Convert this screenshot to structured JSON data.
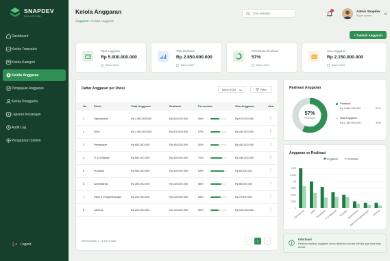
{
  "brand": {
    "name": "SNAPDEV",
    "tagline": "SOLUTIONS"
  },
  "sidebar": {
    "items": [
      {
        "label": "Dashboard",
        "icon": "home-icon"
      },
      {
        "label": "Kelola Transaksi",
        "icon": "transaction-icon"
      },
      {
        "label": "Kelola Kategori",
        "icon": "category-icon"
      },
      {
        "label": "Kelola Anggaran",
        "icon": "budget-icon",
        "active": true
      },
      {
        "label": "Pengajuan Anggaran",
        "icon": "submission-icon"
      },
      {
        "label": "Kelola Pengguna",
        "icon": "users-icon"
      },
      {
        "label": "Laporan Keuangan",
        "icon": "report-icon"
      },
      {
        "label": "Audit Log",
        "icon": "audit-icon"
      },
      {
        "label": "Pengaturan Sistem",
        "icon": "gear-icon"
      }
    ],
    "logout": "Logout"
  },
  "header": {
    "title": "Kelola Anggaran",
    "breadcrumb": [
      "Anggaran",
      "/",
      "Kelola Anggaran"
    ],
    "search_placeholder": "Cari sesuatu...",
    "user_name": "Admin Snapdev",
    "user_role": "Super Admin",
    "add_button": "+ Tambah Anggaran"
  },
  "stats": [
    {
      "label": "Total Anggaran",
      "value": "Rp 5.000.000.000",
      "foot": "Tahun 2024",
      "color": "#2f8f54",
      "bg": "#e3f2e8",
      "icon": "wallet-icon"
    },
    {
      "label": "Total Realisasi",
      "value": "Rp 2.850.000.000",
      "foot": "Tahun 2024",
      "color": "#3f7fd9",
      "bg": "#e4eefb",
      "icon": "chart-icon"
    },
    {
      "label": "Persentase Realisasi",
      "value": "57%",
      "foot": "Tahun 2024",
      "color": "#2f8f54",
      "bg": "#e3f2e8",
      "icon": "percent-icon"
    },
    {
      "label": "Sisa Anggaran",
      "value": "Rp 2.150.000.000",
      "foot": "Tahun 2024",
      "color": "#e5a12a",
      "bg": "#fcf1dc",
      "icon": "coin-icon"
    }
  ],
  "table": {
    "title": "Daftar Anggaran per Divisi",
    "year_select": "Tahun 2024",
    "filter_label": "Filter",
    "columns": [
      "No",
      "Divisi",
      "Total Anggaran",
      "Realisasi",
      "Persentase",
      "Sisa Anggaran",
      "Aksi"
    ],
    "rows": [
      {
        "no": "1",
        "divisi": "Operasional",
        "total": "Rp 1.500.000.000",
        "realisasi": "Rp 825.000.000",
        "pct": "55%",
        "pct_value": 55,
        "sisa": "Rp 675.000.000"
      },
      {
        "no": "2",
        "divisi": "SDM",
        "total": "Rp 1.000.000.000",
        "realisasi": "Rp 570.000.000",
        "pct": "57%",
        "pct_value": 57,
        "sisa": "Rp 430.000.000"
      },
      {
        "no": "3",
        "divisi": "Pemasaran",
        "total": "Rp 800.000.000",
        "realisasi": "Rp 400.000.000",
        "pct": "50%",
        "pct_value": 50,
        "sisa": "Rp 400.000.000"
      },
      {
        "no": "4",
        "divisi": "IT & Software",
        "total": "Rp 600.000.000",
        "realisasi": "Rp 420.000.000",
        "pct": "70%",
        "pct_value": 70,
        "sisa": "Rp 180.000.000"
      },
      {
        "no": "5",
        "divisi": "Produksi",
        "total": "Rp 500.000.000",
        "realisasi": "Rp 420.000.000",
        "pct": "84%",
        "pct_value": 84,
        "sisa": "Rp 80.000.000"
      },
      {
        "no": "6",
        "divisi": "Administrasi",
        "total": "Rp 250.000.000",
        "realisasi": "Rp 165.000.000",
        "pct": "66%",
        "pct_value": 66,
        "sisa": "Rp 85.000.000"
      },
      {
        "no": "7",
        "divisi": "Riset & Pengembangan",
        "total": "Rp 200.000.000",
        "realisasi": "Rp 125.000.000",
        "pct": "63%",
        "pct_value": 63,
        "sisa": "Rp 75.000.000"
      },
      {
        "no": "8",
        "divisi": "Lainnya",
        "total": "Rp 200.000.000",
        "realisasi": "Rp 100.000.000",
        "pct": "50%",
        "pct_value": 50,
        "sisa": "Rp 100.000.000"
      }
    ],
    "footer": "Menampilkan 1 - 8 dari 8 data",
    "pages": [
      "‹",
      "1",
      "›"
    ]
  },
  "realisasi_card": {
    "title": "Realisasi Anggaran",
    "center_value": "57%",
    "center_label": "Realisasi",
    "legend": [
      {
        "name": "Realisasi",
        "amount": "Rp 2.850.000.000",
        "pct": "57%",
        "color": "#2f8f54"
      },
      {
        "name": "Sisa Anggaran",
        "amount": "Rp 2.150.000.000",
        "pct": "43%",
        "color": "#d6ddd8"
      }
    ]
  },
  "chart_card": {
    "title": "Anggaran vs Realisasi"
  },
  "chart_data": {
    "type": "bar",
    "categories": [
      "Operasional",
      "SDM",
      "Pemasaran",
      "IT & Software",
      "Produksi",
      "Administrasi",
      "Riset & Pengembangan",
      "Lainnya"
    ],
    "series": [
      {
        "name": "Anggaran",
        "values": [
          1500,
          1000,
          800,
          600,
          500,
          250,
          200,
          200
        ],
        "color": "#1f7a45"
      },
      {
        "name": "Realisasi",
        "values": [
          825,
          570,
          400,
          420,
          420,
          165,
          125,
          100
        ],
        "color": "#9fd9b0"
      }
    ],
    "y_ticks": [
      "1.5M",
      "1.25M",
      "1M",
      "750K",
      "500K",
      "250K",
      "0"
    ],
    "ylim": [
      0,
      1500
    ],
    "legend_position": "top"
  },
  "info_card": {
    "title": "Informasi",
    "text": "Pastikan realisasi anggaran selalu diperbarui secara berkala agar data tetap akurat."
  }
}
